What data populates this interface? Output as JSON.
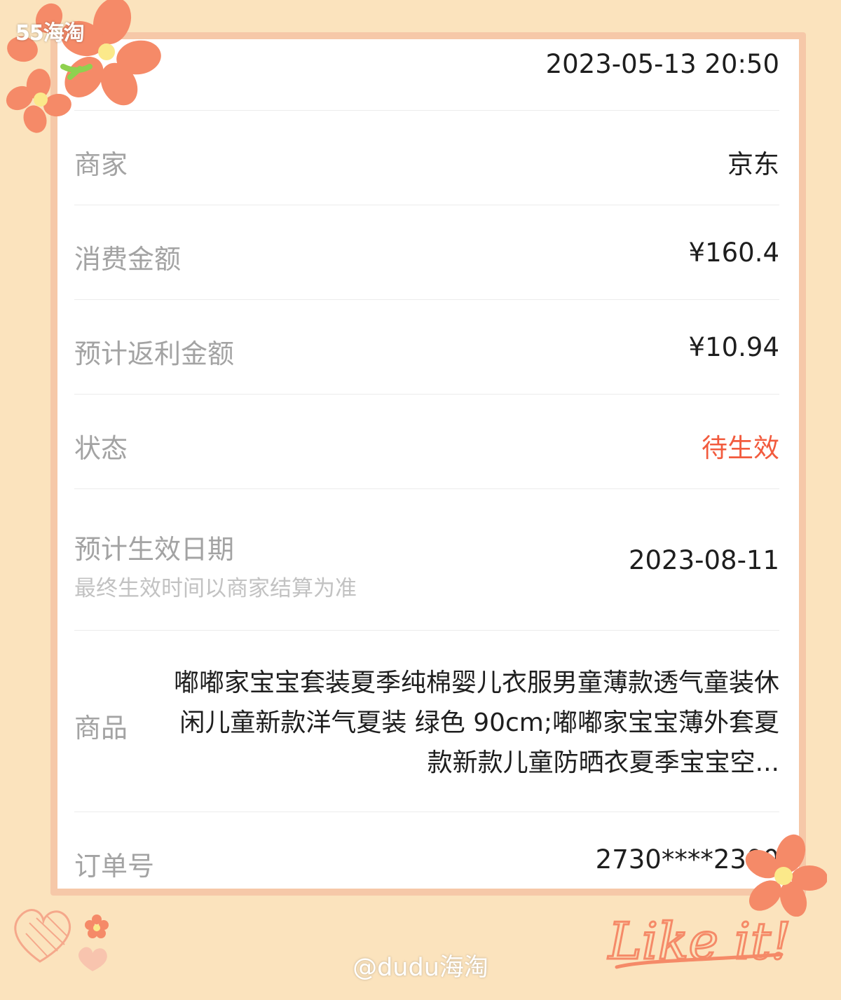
{
  "watermark": {
    "logo": "55海淘",
    "user": "@dudu海淘"
  },
  "sticker": {
    "text": "Like it!"
  },
  "order": {
    "datetime": "2023-05-13 20:50",
    "merchant_label": "商家",
    "merchant_value": "京东",
    "amount_label": "消费金额",
    "amount_value": "¥160.4",
    "rebate_label": "预计返利金额",
    "rebate_value": "¥10.94",
    "status_label": "状态",
    "status_value": "待生效",
    "effective_label": "预计生效日期",
    "effective_note": "最终生效时间以商家结算为准",
    "effective_value": "2023-08-11",
    "product_label": "商品",
    "product_value": "嘟嘟家宝宝套装夏季纯棉婴儿衣服男童薄款透气童装休闲儿童新款洋气夏装 绿色 90cm;嘟嘟家宝宝薄外套夏款新款儿童防晒衣夏季宝宝空...",
    "order_no_label": "订单号",
    "order_no_value": "2730****2300"
  },
  "colors": {
    "background": "#fbe3bd",
    "frame": "#f6c8a8",
    "status": "#f25b3e",
    "flower": "#f58a68"
  }
}
